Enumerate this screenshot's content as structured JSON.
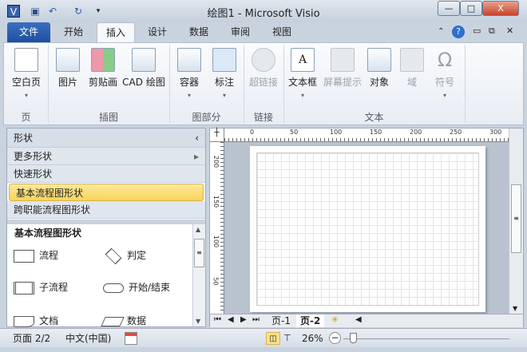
{
  "window": {
    "title": "绘图1 - Microsoft Visio",
    "app_icon": "V",
    "minimize": "—",
    "maximize": "□",
    "close": "X"
  },
  "tabs": [
    "文件",
    "开始",
    "插入",
    "设计",
    "数据",
    "审阅",
    "视图"
  ],
  "ribbon": {
    "buttons": [
      {
        "label": "空白页",
        "dd": "▾"
      },
      {
        "label": "图片"
      },
      {
        "label": "剪贴画"
      },
      {
        "label": "CAD 绘图"
      },
      {
        "label": "容器",
        "dd": "▾"
      },
      {
        "label": "标注",
        "dd": "▾"
      },
      {
        "label": "超链接",
        "disabled": true
      },
      {
        "label": "文本框",
        "dd": "▾"
      },
      {
        "label": "屏幕提示",
        "disabled": true
      },
      {
        "label": "对象"
      },
      {
        "label": "域",
        "disabled": true
      },
      {
        "label": "符号",
        "disabled": true,
        "dd": "▾"
      }
    ],
    "groups": [
      "页",
      "插图",
      "图部分",
      "链接",
      "文本"
    ]
  },
  "shapes_panel": {
    "title": "形状",
    "collapse": "‹",
    "more": "更多形状",
    "more_arrow": "▸",
    "quick": "快速形状",
    "basic": "基本流程图形状",
    "cross": "跨职能流程图形状",
    "stencil_title": "基本流程图形状",
    "items": [
      "流程",
      "判定",
      "子流程",
      "开始/结束",
      "文档",
      "数据"
    ]
  },
  "rulers": {
    "h": [
      "0",
      "50",
      "100",
      "150",
      "200",
      "250",
      "300"
    ],
    "v": [
      "200",
      "150",
      "100",
      "50"
    ]
  },
  "page_tabs": [
    "页-1",
    "页-2"
  ],
  "status": {
    "page": "页面 2/2",
    "language": "中文(中国)",
    "zoom": "26%"
  }
}
